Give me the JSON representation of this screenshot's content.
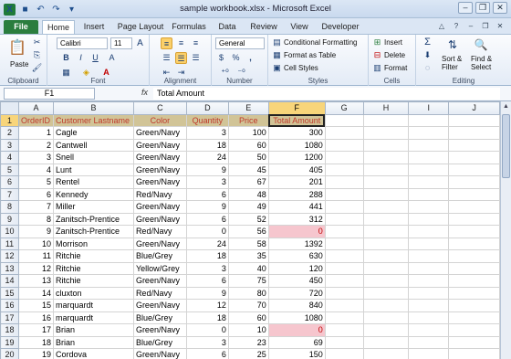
{
  "window": {
    "title": "sample workbook.xlsx  -  Microsoft Excel"
  },
  "quick_access": {
    "excel_icon": "X",
    "save_icon": "save-icon",
    "undo_icon": "undo-icon",
    "redo_icon": "redo-icon"
  },
  "window_buttons": {
    "minimize": "–",
    "restore": "❐",
    "close": "✕"
  },
  "tabs": [
    "File",
    "Home",
    "Insert",
    "Page Layout",
    "Formulas",
    "Data",
    "Review",
    "View",
    "Developer"
  ],
  "ribbon": {
    "clipboard": {
      "label": "Clipboard",
      "paste": "Paste"
    },
    "font": {
      "label": "Font",
      "name": "Calibri",
      "size": "11",
      "grow": "A",
      "shrink": "A",
      "bold": "B",
      "italic": "I",
      "underline": "U"
    },
    "alignment": {
      "label": "Alignment"
    },
    "number": {
      "label": "Number",
      "format": "General",
      "currency": "$",
      "percent": "%",
      "comma": ","
    },
    "styles": {
      "label": "Styles",
      "cond": "Conditional Formatting",
      "table": "Format as Table",
      "cell": "Cell Styles"
    },
    "cells": {
      "label": "Cells",
      "insert": "Insert",
      "delete": "Delete",
      "format": "Format"
    },
    "editing": {
      "label": "Editing",
      "sum": "Σ",
      "sort": "Sort &",
      "sort2": "Filter",
      "find": "Find &",
      "find2": "Select"
    }
  },
  "formula_bar": {
    "name_box": "F1",
    "fx": "fx",
    "value": "Total Amount"
  },
  "columns": [
    "A",
    "B",
    "C",
    "D",
    "E",
    "F",
    "G",
    "H",
    "I",
    "J"
  ],
  "headers": [
    "OrderID",
    "Customer Lastname",
    "Color",
    "Quantity",
    "Price",
    "Total Amount"
  ],
  "rows": [
    {
      "id": "1",
      "name": "Cagle",
      "color": "Green/Navy",
      "qty": "3",
      "price": "100",
      "total": "300"
    },
    {
      "id": "2",
      "name": "Cantwell",
      "color": "Green/Navy",
      "qty": "18",
      "price": "60",
      "total": "1080"
    },
    {
      "id": "3",
      "name": "Snell",
      "color": "Green/Navy",
      "qty": "24",
      "price": "50",
      "total": "1200"
    },
    {
      "id": "4",
      "name": "Lunt",
      "color": "Green/Navy",
      "qty": "9",
      "price": "45",
      "total": "405"
    },
    {
      "id": "5",
      "name": "Rentel",
      "color": "Green/Navy",
      "qty": "3",
      "price": "67",
      "total": "201"
    },
    {
      "id": "6",
      "name": "Kennedy",
      "color": "Red/Navy",
      "qty": "6",
      "price": "48",
      "total": "288"
    },
    {
      "id": "7",
      "name": "Miller",
      "color": "Green/Navy",
      "qty": "9",
      "price": "49",
      "total": "441"
    },
    {
      "id": "8",
      "name": "Zanitsch-Prentice",
      "color": "Green/Navy",
      "qty": "6",
      "price": "52",
      "total": "312"
    },
    {
      "id": "9",
      "name": "Zanitsch-Prentice",
      "color": "Red/Navy",
      "qty": "0",
      "price": "56",
      "total": "0",
      "pink": true
    },
    {
      "id": "10",
      "name": "Morrison",
      "color": "Green/Navy",
      "qty": "24",
      "price": "58",
      "total": "1392"
    },
    {
      "id": "11",
      "name": "Ritchie",
      "color": "Blue/Grey",
      "qty": "18",
      "price": "35",
      "total": "630"
    },
    {
      "id": "12",
      "name": "Ritchie",
      "color": "Yellow/Grey",
      "qty": "3",
      "price": "40",
      "total": "120"
    },
    {
      "id": "13",
      "name": "Ritchie",
      "color": "Green/Navy",
      "qty": "6",
      "price": "75",
      "total": "450"
    },
    {
      "id": "14",
      "name": "cluxton",
      "color": "Red/Navy",
      "qty": "9",
      "price": "80",
      "total": "720"
    },
    {
      "id": "15",
      "name": "marquardt",
      "color": "Green/Navy",
      "qty": "12",
      "price": "70",
      "total": "840"
    },
    {
      "id": "16",
      "name": "marquardt",
      "color": "Blue/Grey",
      "qty": "18",
      "price": "60",
      "total": "1080"
    },
    {
      "id": "17",
      "name": "Brian",
      "color": "Green/Navy",
      "qty": "0",
      "price": "10",
      "total": "0",
      "pink": true
    },
    {
      "id": "18",
      "name": "Brian",
      "color": "Blue/Grey",
      "qty": "3",
      "price": "23",
      "total": "69"
    },
    {
      "id": "19",
      "name": "Cordova",
      "color": "Green/Navy",
      "qty": "6",
      "price": "25",
      "total": "150"
    }
  ],
  "colors": {
    "header_fill": "#d1c497",
    "header_text": "#c0392b",
    "zero_fill": "#f6c6ce",
    "zero_text": "#c00000",
    "selection": "#f8d57a"
  }
}
